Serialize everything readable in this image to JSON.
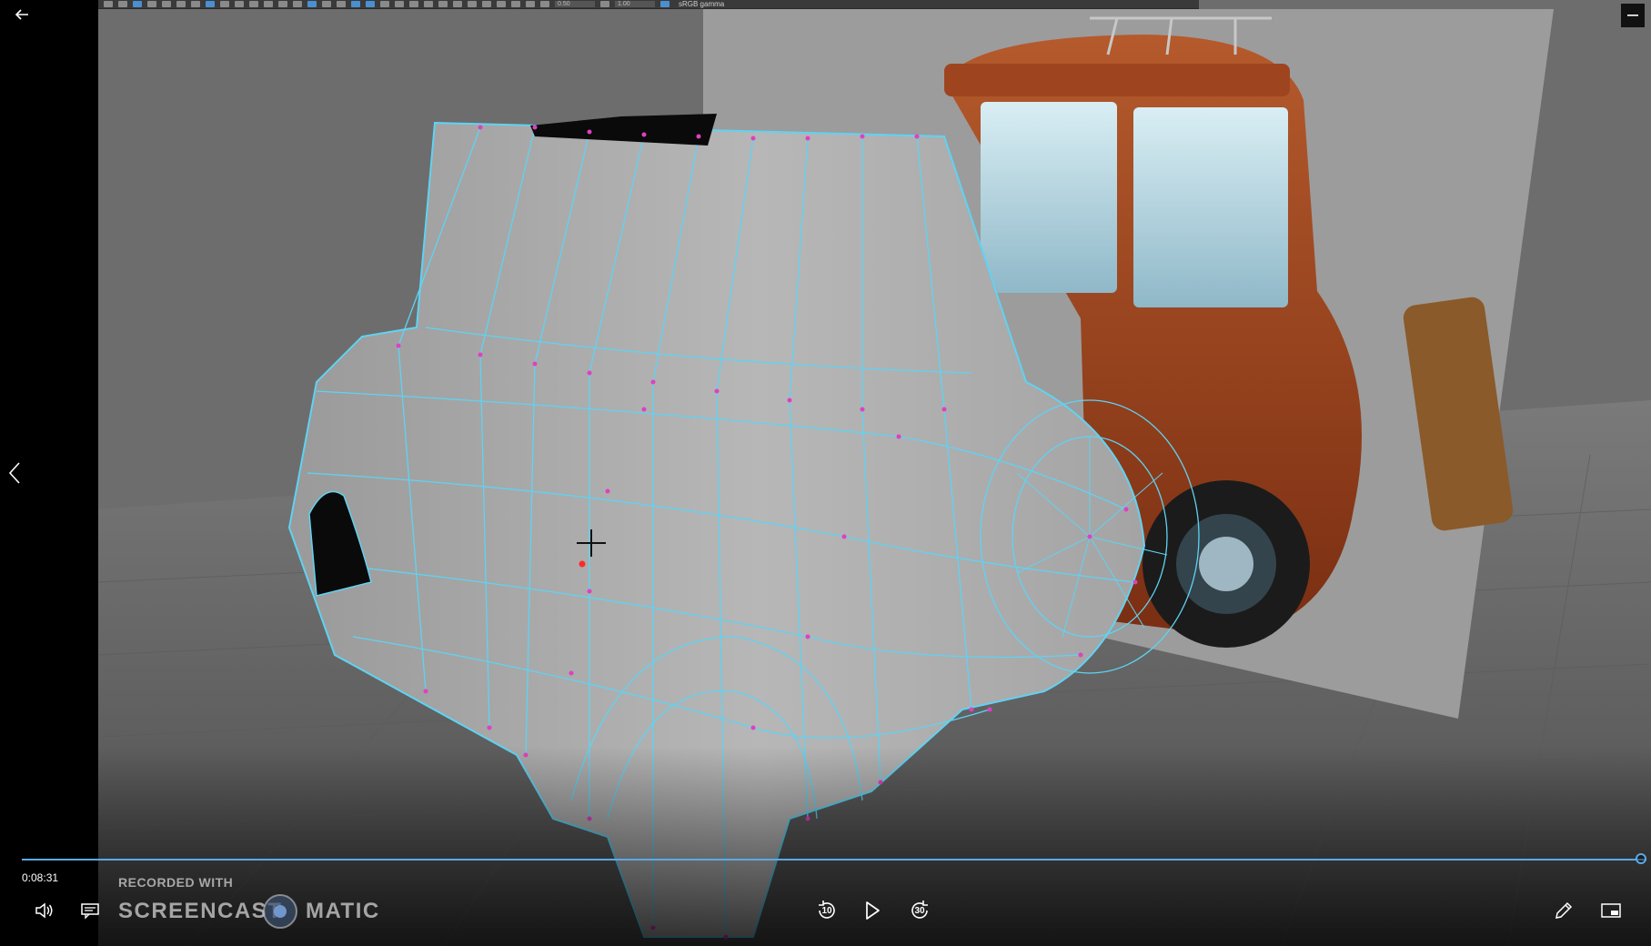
{
  "app_toolbar": {
    "field_1": "0.50",
    "field_2": "1.00",
    "colorspace_label": "sRGB gamma"
  },
  "player": {
    "current_time": "0:08:31",
    "progress_fraction": 1.0,
    "rewind_seconds": "10",
    "forward_seconds": "30",
    "accent_color": "#5aa9e6"
  },
  "watermark": {
    "line1": "RECORDED WITH",
    "brand_left": "SCREENCAST",
    "brand_right": "MATIC"
  },
  "icons": {
    "back": "arrow-left-icon",
    "previous": "chevron-left-icon",
    "minimize": "minimize-icon",
    "volume": "speaker-icon",
    "captions": "captions-icon",
    "rewind": "rewind-10-icon",
    "play": "play-icon",
    "forward": "forward-30-icon",
    "edit": "pencil-icon",
    "miniview": "miniview-icon"
  },
  "scene": {
    "mesh_wire_color": "#5fd3f3",
    "vertex_color": "#e040c0",
    "reference_car_color": "#a8471f"
  }
}
